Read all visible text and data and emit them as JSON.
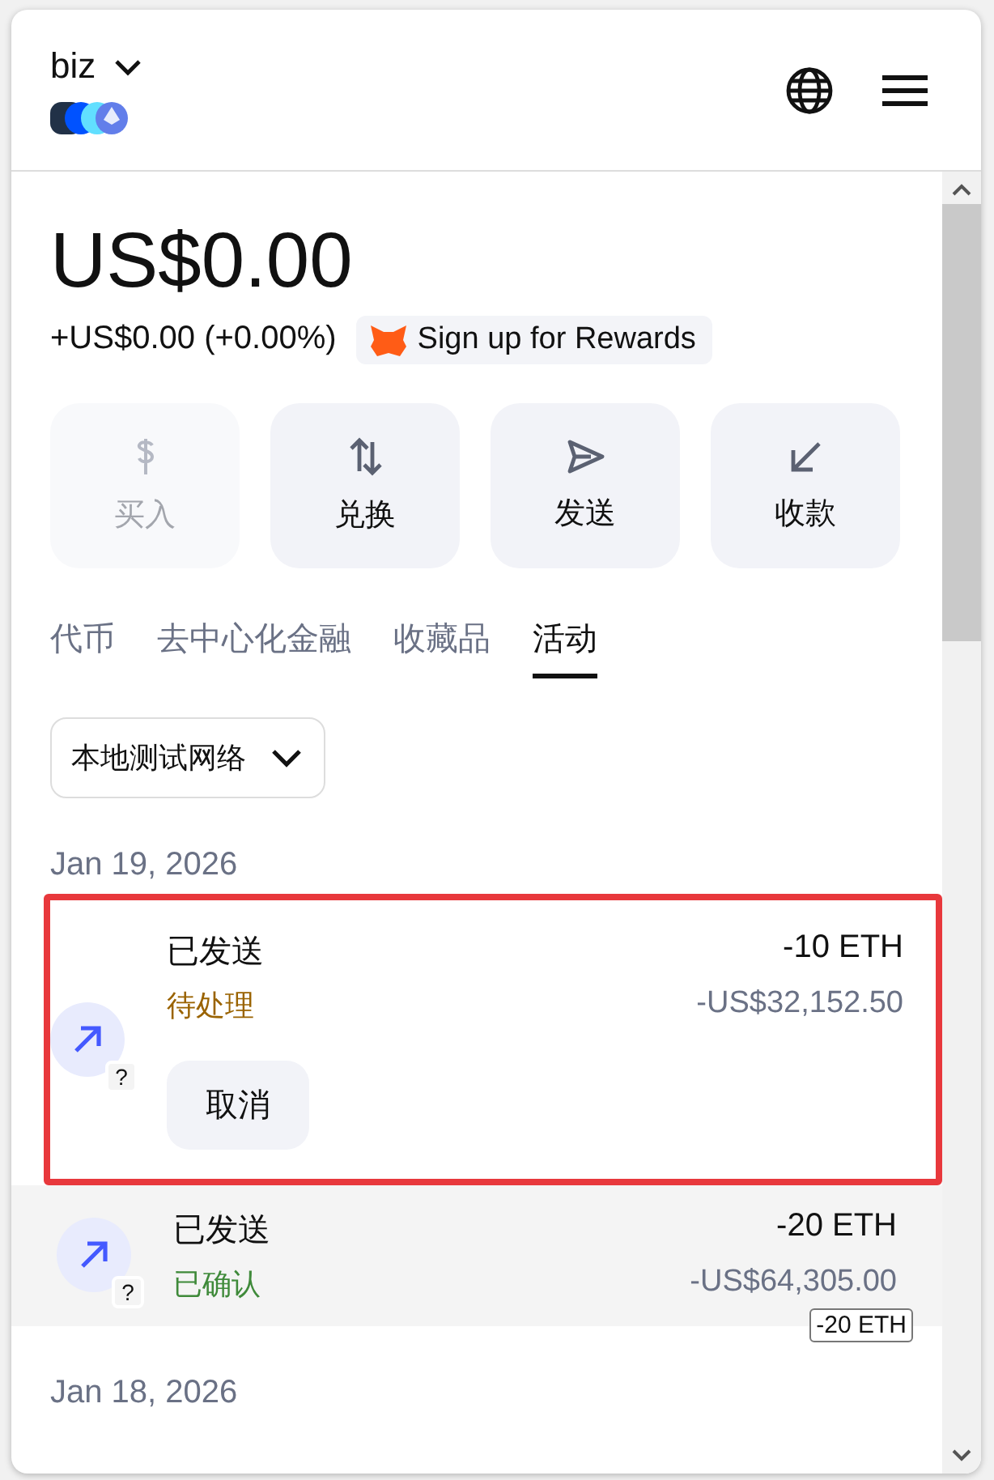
{
  "account": {
    "name": "biz"
  },
  "balance": {
    "total": "US$0.00",
    "change": "+US$0.00 (+0.00%)"
  },
  "rewards": {
    "label": "Sign up for Rewards"
  },
  "actions": [
    {
      "kind": "buy",
      "label": "买入",
      "disabled": true
    },
    {
      "kind": "swap",
      "label": "兑换",
      "disabled": false
    },
    {
      "kind": "send",
      "label": "发送",
      "disabled": false
    },
    {
      "kind": "receive",
      "label": "收款",
      "disabled": false
    }
  ],
  "tabs": [
    {
      "label": "代币",
      "selected": false
    },
    {
      "label": "去中心化金融",
      "selected": false
    },
    {
      "label": "收藏品",
      "selected": false
    },
    {
      "label": "活动",
      "selected": true
    }
  ],
  "network_filter": {
    "value": "本地测试网络"
  },
  "groups": [
    {
      "date": "Jan 19, 2026",
      "transactions": [
        {
          "title": "已发送",
          "status": "待处理",
          "kind": "pending",
          "amount": "-10 ETH",
          "fiat": "-US$32,152.50",
          "network_badge": "?",
          "action": "取消",
          "highlighted": true,
          "hovered": false
        },
        {
          "title": "已发送",
          "status": "已确认",
          "kind": "confirmed",
          "amount": "-20 ETH",
          "fiat": "-US$64,305.00",
          "network_badge": "?",
          "highlighted": false,
          "hovered": true,
          "tooltip": "-20 ETH"
        }
      ]
    },
    {
      "date": "Jan 18, 2026"
    }
  ]
}
